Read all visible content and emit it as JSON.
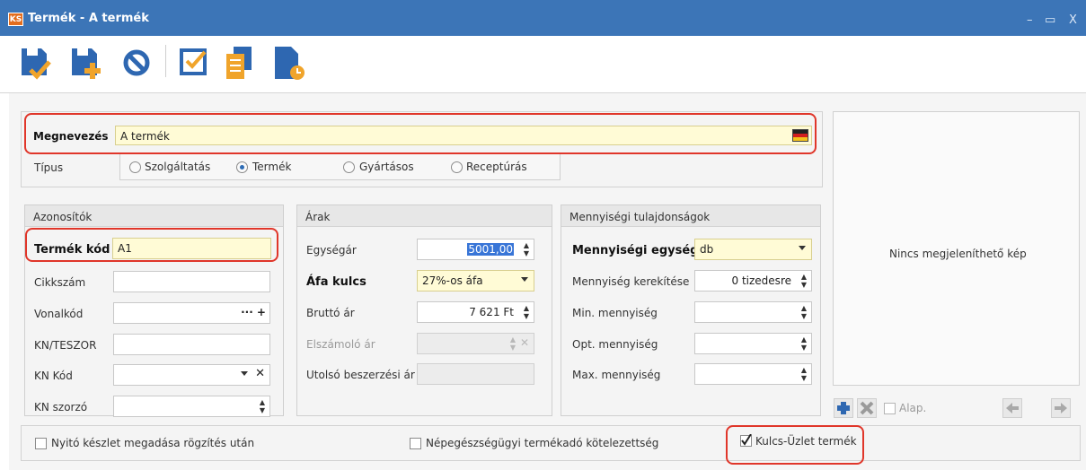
{
  "window": {
    "logo": "KS",
    "title": "Termék - A termék",
    "controls": {
      "minimize": "–",
      "maximize": "▭",
      "close": "X"
    }
  },
  "toolbar": {
    "buttons": [
      "save-close",
      "save-new",
      "cancel",
      "check",
      "copy",
      "history"
    ]
  },
  "main": {
    "name_label": "Megnevezés",
    "name_value": "A termék",
    "type_label": "Típus",
    "types": [
      {
        "label": "Szolgáltatás",
        "selected": false
      },
      {
        "label": "Termék",
        "selected": true
      },
      {
        "label": "Gyártásos",
        "selected": false
      },
      {
        "label": "Receptúrás",
        "selected": false
      }
    ]
  },
  "identifiers": {
    "title": "Azonosítók",
    "product_code_label": "Termék kód",
    "product_code_value": "A1",
    "article_label": "Cikkszám",
    "barcode_label": "Vonalkód",
    "barcode_actions": "··· +",
    "kn_teszor_label": "KN/TESZOR",
    "kn_code_label": "KN Kód",
    "kn_multiplier_label": "KN szorzó"
  },
  "prices": {
    "title": "Árak",
    "unit_price_label": "Egységár",
    "unit_price_value": "5001,00",
    "vat_label": "Áfa kulcs",
    "vat_value": "27%-os áfa",
    "gross_label": "Bruttó ár",
    "gross_value": "7 621 Ft",
    "settlement_label": "Elszámoló ár",
    "last_purchase_label": "Utolsó beszerzési ár"
  },
  "quantity": {
    "title": "Mennyiségi tulajdonságok",
    "unit_label": "Mennyiségi egység",
    "unit_value": "db",
    "rounding_label": "Mennyiség kerekítése",
    "rounding_value": "0 tizedesre",
    "min_label": "Min. mennyiség",
    "opt_label": "Opt. mennyiség",
    "max_label": "Max. mennyiség"
  },
  "image": {
    "no_image_text": "Nincs megjeleníthető kép",
    "default_label": "Alap."
  },
  "footer": {
    "opening_stock_label": "Nyitó készlet megadása rögzítés után",
    "opening_stock_checked": false,
    "public_health_label": "Népegészségügyi termékadó kötelezettség",
    "public_health_checked": false,
    "key_store_label": "Kulcs-Üzlet termék",
    "key_store_checked": true
  },
  "colors": {
    "title_bar": "#3c75b7",
    "highlight": "#e0362a",
    "field_yellow": "#fffbd6",
    "selection": "#3875d7",
    "icon_blue": "#2e67b1"
  }
}
